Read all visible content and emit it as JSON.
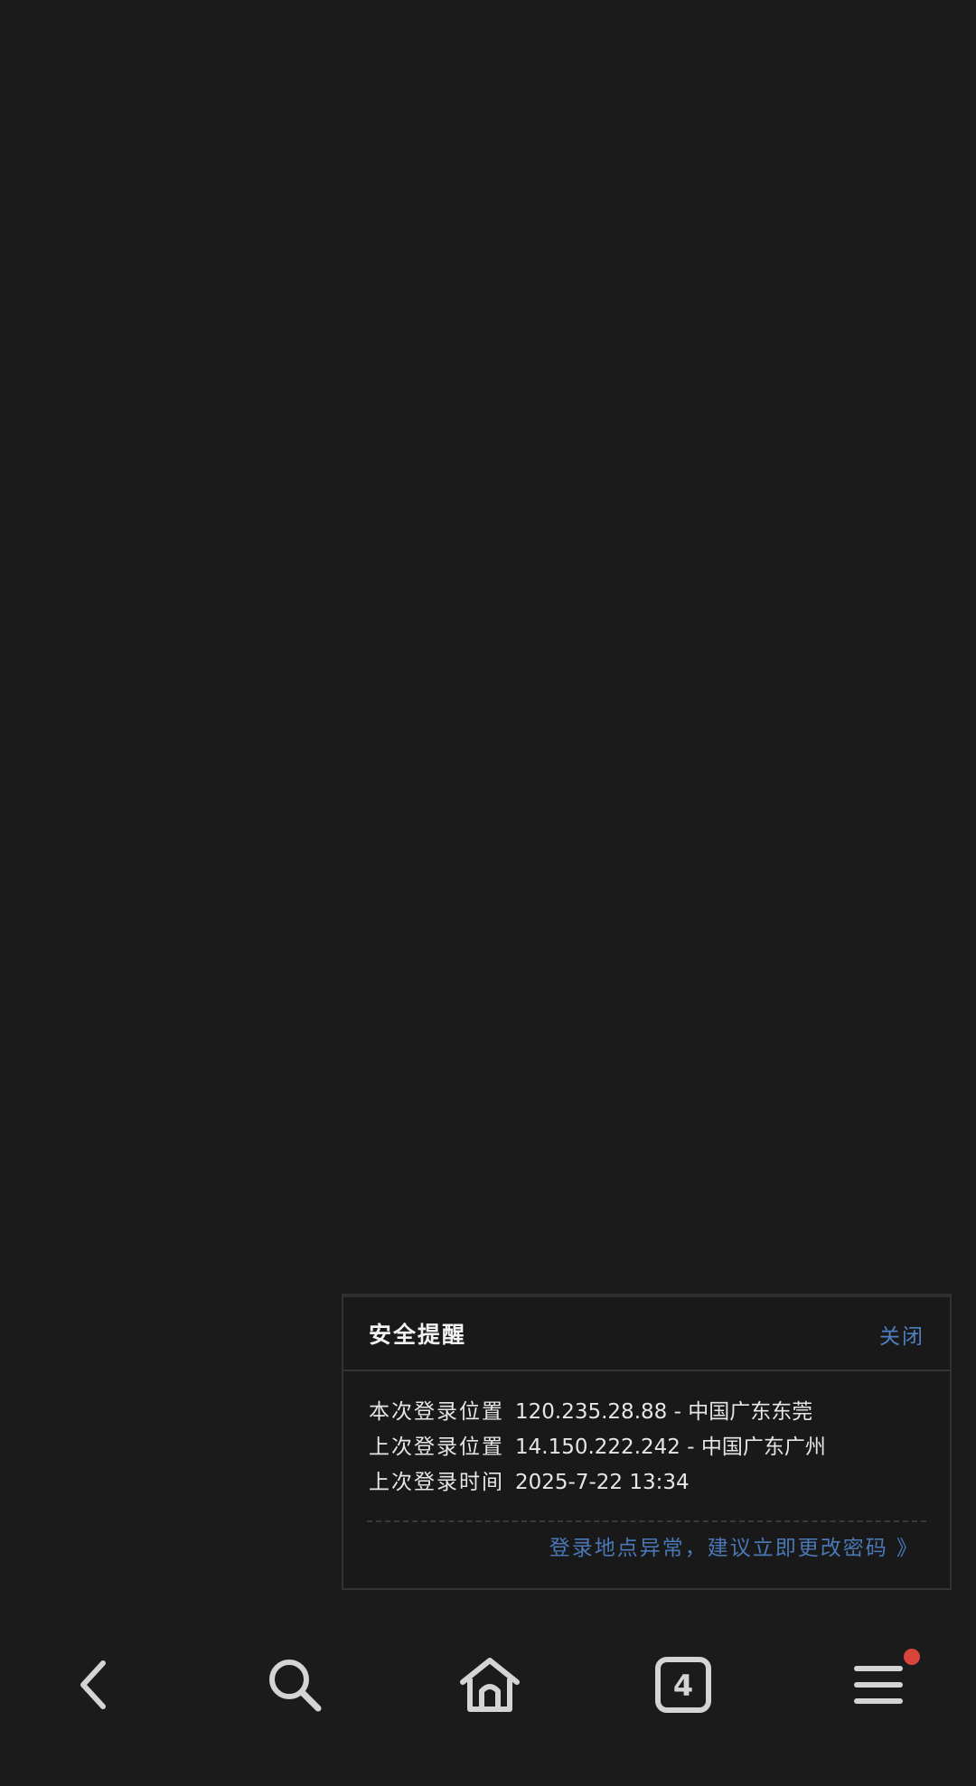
{
  "security_popup": {
    "title": "安全提醒",
    "close_label": "关闭",
    "lines": [
      {
        "label": "本次登录位置",
        "value": "120.235.28.88 - 中国广东东莞"
      },
      {
        "label": "上次登录位置",
        "value": "14.150.222.242 - 中国广东广州"
      },
      {
        "label": "上次登录时间",
        "value": "2025-7-22 13:34"
      }
    ],
    "change_password_link": "登录地点异常，建议立即更改密码 》"
  },
  "bottom_nav": {
    "tabs_count": "4",
    "icons": [
      "back-icon",
      "search-icon",
      "home-icon",
      "tabs-icon",
      "menu-icon"
    ],
    "badge_color": "#d9443b",
    "icon_color": "#d4d4d4"
  }
}
